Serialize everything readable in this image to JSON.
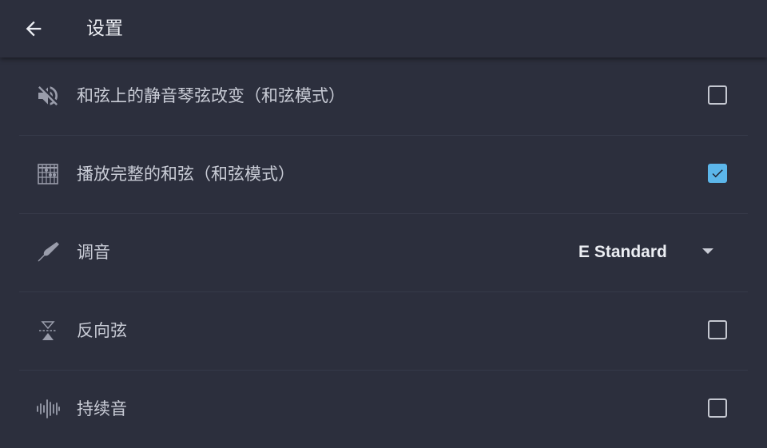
{
  "header": {
    "title": "设置",
    "back_icon": "arrow-left-icon"
  },
  "settings": [
    {
      "label": "和弦上的静音琴弦改变（和弦模式）",
      "icon": "volume-off-icon",
      "control": "checkbox",
      "checked": false
    },
    {
      "label": "播放完整的和弦（和弦模式）",
      "icon": "chord-grid-icon",
      "control": "checkbox",
      "checked": true
    },
    {
      "label": "调音",
      "icon": "tuning-fork-icon",
      "control": "dropdown",
      "value": "E Standard"
    },
    {
      "label": "反向弦",
      "icon": "flip-vertical-icon",
      "control": "checkbox",
      "checked": false
    },
    {
      "label": "持续音",
      "icon": "waveform-icon",
      "control": "checkbox",
      "checked": false
    }
  ],
  "colors": {
    "background": "#2c2f3d",
    "accent": "#5cb6ea",
    "text": "#c9ccd6"
  }
}
